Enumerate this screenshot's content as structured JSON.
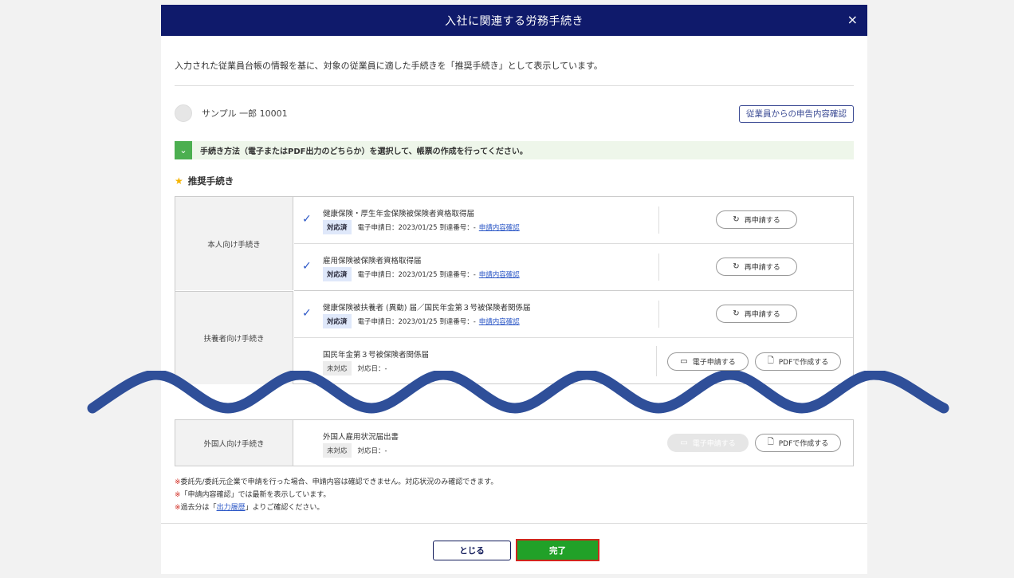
{
  "modal": {
    "title": "入社に関連する労務手続き",
    "close_icon": "×"
  },
  "intro": "入力された従業員台帳の情報を基に、対象の従業員に適した手続きを「推奨手続き」として表示しています。",
  "employee": {
    "name": "サンプル 一郎 10001",
    "confirm_button": "従業員からの申告内容確認"
  },
  "notice": "手続き方法（電子またはPDF出力のどちらか）を選択して、帳票の作成を行ってください。",
  "section_title": "推奨手続き",
  "groups": [
    {
      "label": "本人向け手続き",
      "procedures": [
        {
          "name": "健康保険・厚生年金保険被保険者資格取得届",
          "status": "対応済",
          "meta": "電子申請日：2023/01/25 到達番号：-",
          "link": "申請内容確認",
          "action": "再申請する"
        },
        {
          "name": "雇用保険被保険者資格取得届",
          "status": "対応済",
          "meta": "電子申請日：2023/01/25 到達番号：-",
          "link": "申請内容確認",
          "action": "再申請する"
        }
      ]
    },
    {
      "label": "扶養者向け手続き",
      "procedures": [
        {
          "name": "健康保険被扶養者 (異動) 届／国民年金第３号被保険者関係届",
          "status": "対応済",
          "meta": "電子申請日：2023/01/25 到達番号：-",
          "link": "申請内容確認",
          "action": "再申請する"
        },
        {
          "name": "国民年金第３号被保険者関係届",
          "status": "未対応",
          "meta": "対応日：-",
          "actions": [
            "電子申請する",
            "PDFで作成する"
          ]
        }
      ]
    },
    {
      "label": "外国人向け手続き",
      "procedures": [
        {
          "name": "外国人雇用状況届出書",
          "status": "未対応",
          "meta": "対応日：-",
          "actions": [
            "電子申請する",
            "PDFで作成する"
          ]
        }
      ]
    }
  ],
  "notes": {
    "mark": "※",
    "line1": "委託先/委託元企業で申請を行った場合、申請内容は確認できません。対応状況のみ確認できます。",
    "line2": "「申請内容確認」では最新を表示しています。",
    "line3_pre": "過去分は「",
    "line3_link": "出力履歴",
    "line3_post": "」よりご確認ください。"
  },
  "footer": {
    "close_button": "とじる",
    "done_button": "完了"
  },
  "colors": {
    "header_bg": "#0f1a6b",
    "done_green": "#21a128",
    "highlight_red": "#d0261c",
    "wave_blue": "#2f4f99",
    "link_blue": "#2a56c6"
  }
}
